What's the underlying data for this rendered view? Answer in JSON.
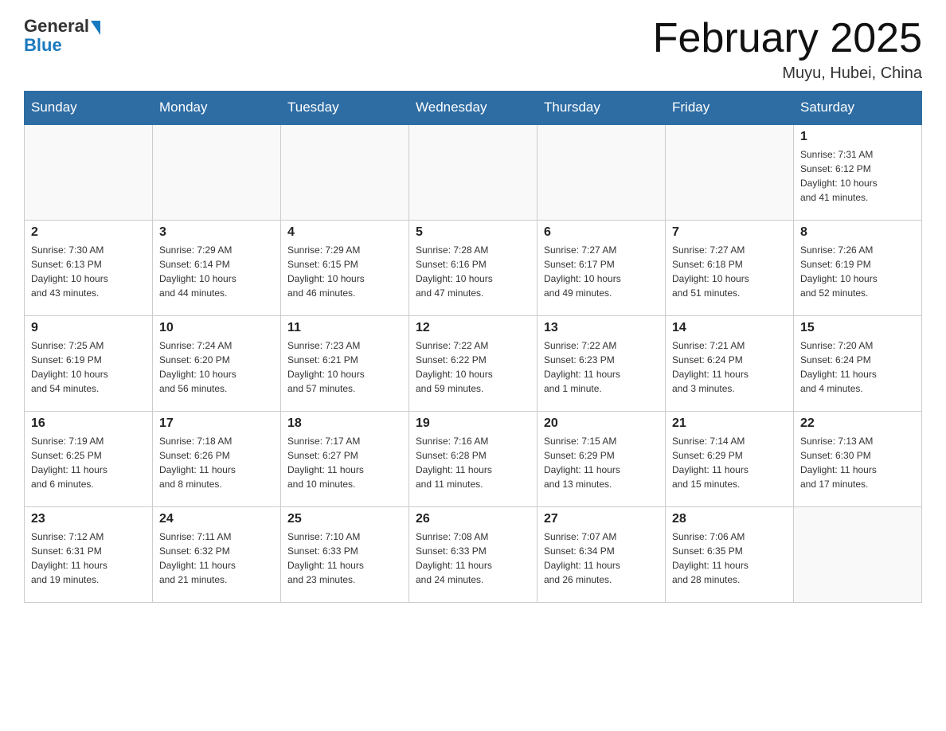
{
  "logo": {
    "general": "General",
    "blue": "Blue"
  },
  "title": "February 2025",
  "location": "Muyu, Hubei, China",
  "days_of_week": [
    "Sunday",
    "Monday",
    "Tuesday",
    "Wednesday",
    "Thursday",
    "Friday",
    "Saturday"
  ],
  "weeks": [
    [
      {
        "day": "",
        "info": ""
      },
      {
        "day": "",
        "info": ""
      },
      {
        "day": "",
        "info": ""
      },
      {
        "day": "",
        "info": ""
      },
      {
        "day": "",
        "info": ""
      },
      {
        "day": "",
        "info": ""
      },
      {
        "day": "1",
        "info": "Sunrise: 7:31 AM\nSunset: 6:12 PM\nDaylight: 10 hours\nand 41 minutes."
      }
    ],
    [
      {
        "day": "2",
        "info": "Sunrise: 7:30 AM\nSunset: 6:13 PM\nDaylight: 10 hours\nand 43 minutes."
      },
      {
        "day": "3",
        "info": "Sunrise: 7:29 AM\nSunset: 6:14 PM\nDaylight: 10 hours\nand 44 minutes."
      },
      {
        "day": "4",
        "info": "Sunrise: 7:29 AM\nSunset: 6:15 PM\nDaylight: 10 hours\nand 46 minutes."
      },
      {
        "day": "5",
        "info": "Sunrise: 7:28 AM\nSunset: 6:16 PM\nDaylight: 10 hours\nand 47 minutes."
      },
      {
        "day": "6",
        "info": "Sunrise: 7:27 AM\nSunset: 6:17 PM\nDaylight: 10 hours\nand 49 minutes."
      },
      {
        "day": "7",
        "info": "Sunrise: 7:27 AM\nSunset: 6:18 PM\nDaylight: 10 hours\nand 51 minutes."
      },
      {
        "day": "8",
        "info": "Sunrise: 7:26 AM\nSunset: 6:19 PM\nDaylight: 10 hours\nand 52 minutes."
      }
    ],
    [
      {
        "day": "9",
        "info": "Sunrise: 7:25 AM\nSunset: 6:19 PM\nDaylight: 10 hours\nand 54 minutes."
      },
      {
        "day": "10",
        "info": "Sunrise: 7:24 AM\nSunset: 6:20 PM\nDaylight: 10 hours\nand 56 minutes."
      },
      {
        "day": "11",
        "info": "Sunrise: 7:23 AM\nSunset: 6:21 PM\nDaylight: 10 hours\nand 57 minutes."
      },
      {
        "day": "12",
        "info": "Sunrise: 7:22 AM\nSunset: 6:22 PM\nDaylight: 10 hours\nand 59 minutes."
      },
      {
        "day": "13",
        "info": "Sunrise: 7:22 AM\nSunset: 6:23 PM\nDaylight: 11 hours\nand 1 minute."
      },
      {
        "day": "14",
        "info": "Sunrise: 7:21 AM\nSunset: 6:24 PM\nDaylight: 11 hours\nand 3 minutes."
      },
      {
        "day": "15",
        "info": "Sunrise: 7:20 AM\nSunset: 6:24 PM\nDaylight: 11 hours\nand 4 minutes."
      }
    ],
    [
      {
        "day": "16",
        "info": "Sunrise: 7:19 AM\nSunset: 6:25 PM\nDaylight: 11 hours\nand 6 minutes."
      },
      {
        "day": "17",
        "info": "Sunrise: 7:18 AM\nSunset: 6:26 PM\nDaylight: 11 hours\nand 8 minutes."
      },
      {
        "day": "18",
        "info": "Sunrise: 7:17 AM\nSunset: 6:27 PM\nDaylight: 11 hours\nand 10 minutes."
      },
      {
        "day": "19",
        "info": "Sunrise: 7:16 AM\nSunset: 6:28 PM\nDaylight: 11 hours\nand 11 minutes."
      },
      {
        "day": "20",
        "info": "Sunrise: 7:15 AM\nSunset: 6:29 PM\nDaylight: 11 hours\nand 13 minutes."
      },
      {
        "day": "21",
        "info": "Sunrise: 7:14 AM\nSunset: 6:29 PM\nDaylight: 11 hours\nand 15 minutes."
      },
      {
        "day": "22",
        "info": "Sunrise: 7:13 AM\nSunset: 6:30 PM\nDaylight: 11 hours\nand 17 minutes."
      }
    ],
    [
      {
        "day": "23",
        "info": "Sunrise: 7:12 AM\nSunset: 6:31 PM\nDaylight: 11 hours\nand 19 minutes."
      },
      {
        "day": "24",
        "info": "Sunrise: 7:11 AM\nSunset: 6:32 PM\nDaylight: 11 hours\nand 21 minutes."
      },
      {
        "day": "25",
        "info": "Sunrise: 7:10 AM\nSunset: 6:33 PM\nDaylight: 11 hours\nand 23 minutes."
      },
      {
        "day": "26",
        "info": "Sunrise: 7:08 AM\nSunset: 6:33 PM\nDaylight: 11 hours\nand 24 minutes."
      },
      {
        "day": "27",
        "info": "Sunrise: 7:07 AM\nSunset: 6:34 PM\nDaylight: 11 hours\nand 26 minutes."
      },
      {
        "day": "28",
        "info": "Sunrise: 7:06 AM\nSunset: 6:35 PM\nDaylight: 11 hours\nand 28 minutes."
      },
      {
        "day": "",
        "info": ""
      }
    ]
  ]
}
